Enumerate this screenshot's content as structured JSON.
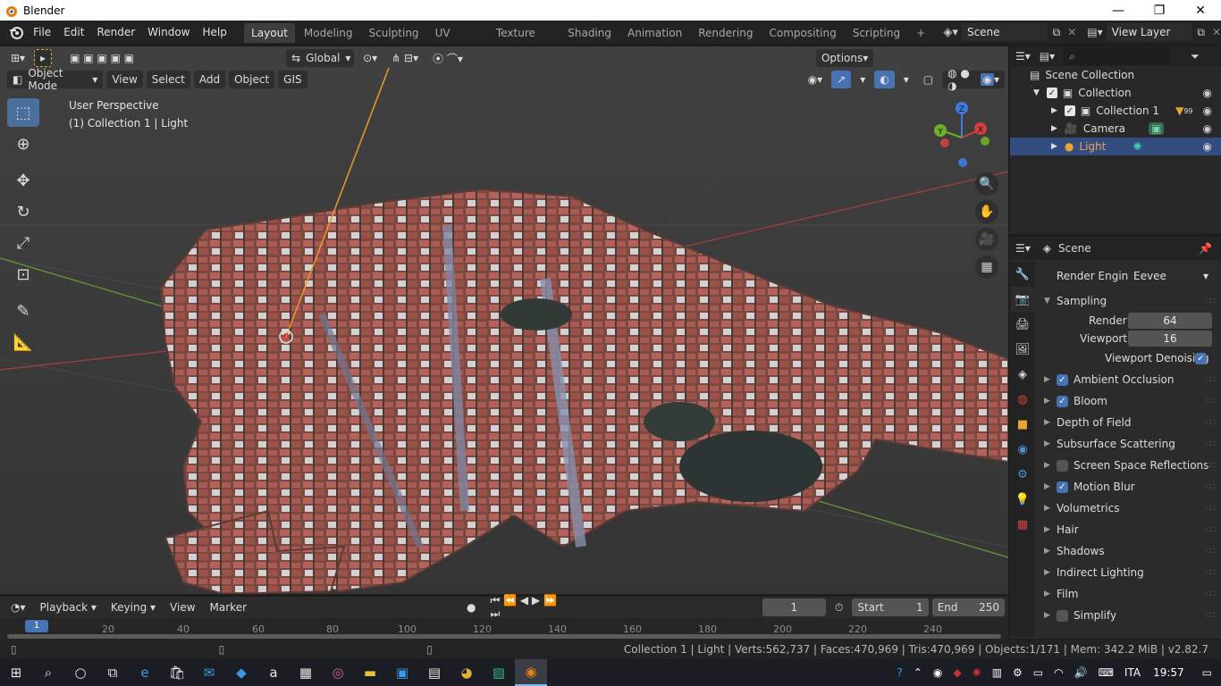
{
  "window": {
    "title": "Blender",
    "minimize": "—",
    "maximize": "❐",
    "close": "✕"
  },
  "menu": [
    "File",
    "Edit",
    "Render",
    "Window",
    "Help"
  ],
  "workspaces": [
    "Layout",
    "Modeling",
    "Sculpting",
    "UV Editing",
    "Texture Paint",
    "Shading",
    "Animation",
    "Rendering",
    "Compositing",
    "Scripting"
  ],
  "add_workspace": "+",
  "scene": {
    "label": "Scene"
  },
  "view_layer": {
    "label": "View Layer"
  },
  "viewport": {
    "transform_orientation": "Global",
    "options_label": "Options",
    "mode": "Object Mode",
    "header_menus": [
      "View",
      "Select",
      "Add",
      "Object",
      "GIS"
    ],
    "overlay_title": "User Perspective",
    "overlay_subtitle": "(1) Collection 1 | Light",
    "gizmo_axes": {
      "z": "Z",
      "y": "Y",
      "x": "X"
    }
  },
  "outliner": {
    "search_placeholder": "",
    "rows": [
      {
        "label": "Scene Collection",
        "depth": 0
      },
      {
        "label": "Collection",
        "depth": 1
      },
      {
        "label": "Collection 1",
        "depth": 2,
        "badge": "99"
      },
      {
        "label": "Camera",
        "depth": 2
      },
      {
        "label": "Light",
        "depth": 2,
        "selected": true
      }
    ]
  },
  "properties": {
    "header": "Scene",
    "render_engine_label": "Render Engine",
    "render_engine_value": "Eevee",
    "sampling": {
      "title": "Sampling",
      "render_label": "Render",
      "render_value": "64",
      "viewport_label": "Viewport",
      "viewport_value": "16",
      "denoise_label": "Viewport Denoising"
    },
    "panels": [
      {
        "label": "Ambient Occlusion",
        "checkbox": true
      },
      {
        "label": "Bloom",
        "checkbox": true
      },
      {
        "label": "Depth of Field"
      },
      {
        "label": "Subsurface Scattering"
      },
      {
        "label": "Screen Space Reflections",
        "checkbox": false
      },
      {
        "label": "Motion Blur",
        "checkbox": true
      },
      {
        "label": "Volumetrics"
      },
      {
        "label": "Hair"
      },
      {
        "label": "Shadows"
      },
      {
        "label": "Indirect Lighting"
      },
      {
        "label": "Film"
      },
      {
        "label": "Simplify",
        "checkbox": false
      }
    ]
  },
  "timeline": {
    "menus": [
      "Playback",
      "Keying",
      "View",
      "Marker"
    ],
    "current_frame": "1",
    "start_label": "Start",
    "start_value": "1",
    "end_label": "End",
    "end_value": "250",
    "ruler_ticks": [
      "20",
      "40",
      "60",
      "80",
      "100",
      "120",
      "140",
      "160",
      "180",
      "200",
      "220",
      "240"
    ],
    "playhead": "1"
  },
  "status": {
    "stats": "Collection 1 | Light | Verts:562,737 | Faces:470,969 | Tris:470,969 | Objects:1/171 | Mem: 342.2 MiB | v2.82.7"
  },
  "taskbar": {
    "language": "ITA",
    "time": "19:57"
  },
  "colors": {
    "accent": "#4772b3",
    "selection": "#334d80",
    "viewport_bg": "#3e3e3e",
    "x_axis": "#d0403f",
    "y_axis": "#6fb029",
    "z_axis": "#3b7ce0"
  }
}
